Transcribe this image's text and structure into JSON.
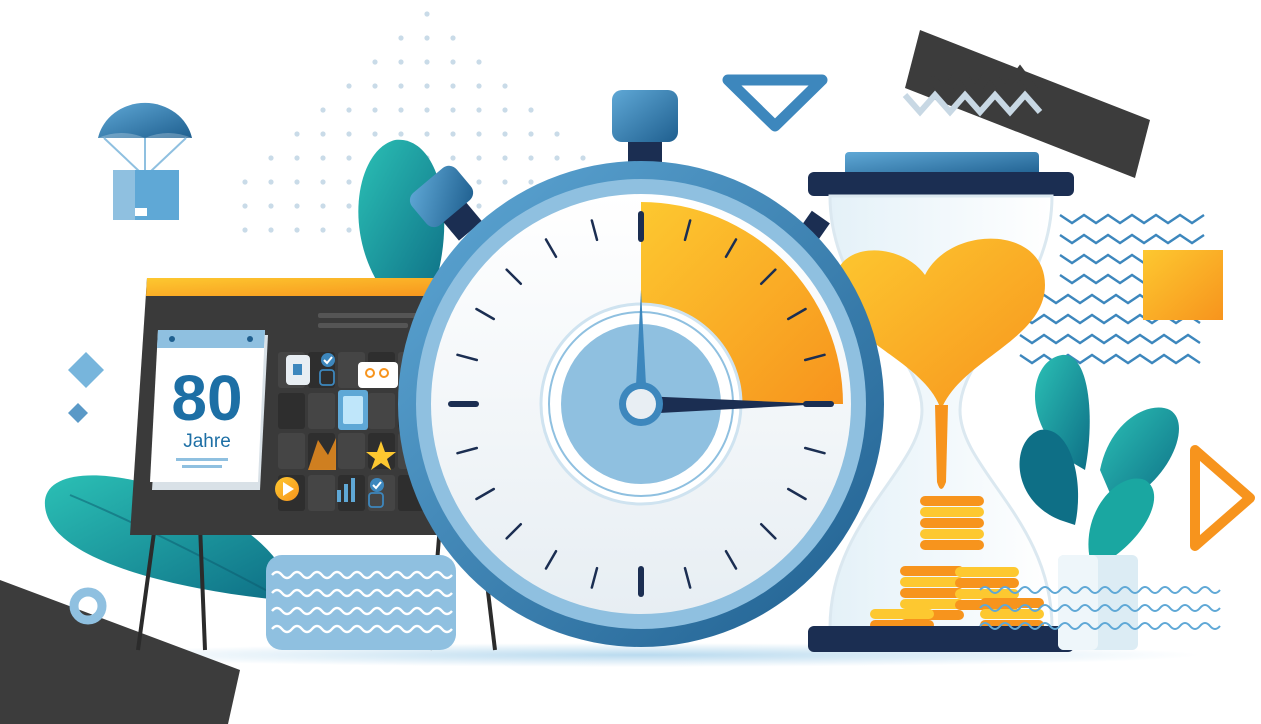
{
  "calendar": {
    "number": "80",
    "word": "Jahre"
  },
  "palette": {
    "blue_dark": "#1f5f8f",
    "blue_mid": "#3d87bd",
    "blue_light": "#8fc0e0",
    "teal": "#1aa7a1",
    "orange": "#f7941d",
    "yellow": "#fdc830",
    "charcoal": "#3c3c3c"
  },
  "icons": [
    "parachute-box-icon",
    "stopwatch-icon",
    "hourglass-icon",
    "presentation-board-icon",
    "calendar-icon",
    "coin-stack-icon",
    "star-icon",
    "play-icon",
    "bar-chart-icon",
    "checkmark-icon"
  ]
}
